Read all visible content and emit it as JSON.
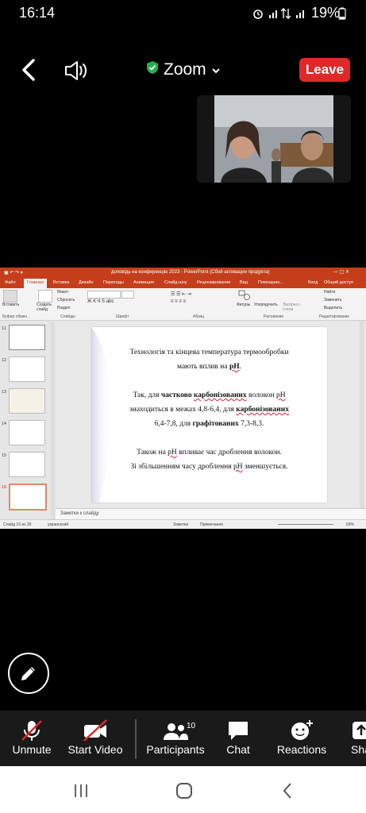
{
  "status_bar": {
    "time": "16:14",
    "battery": "19%"
  },
  "header": {
    "app_title": "Zoom",
    "leave_label": "Leave",
    "accent_leave": "#e02828",
    "shield_color": "#22b14c"
  },
  "ppt": {
    "window_title": "доповідь на конференцію 2023 - PowerPoint (Сбой активации продукта)",
    "tabs": [
      "Файл",
      "Главная",
      "Вставка",
      "Дизайн",
      "Переходы",
      "Анимация",
      "Слайд-шоу",
      "Рецензирование",
      "Вид",
      "Помощник..."
    ],
    "right_tabs": [
      "Вход",
      "Общий доступ"
    ],
    "ribbon_groups": [
      "Буфер обмен...",
      "Слайды",
      "Шрифт",
      "Абзац",
      "Рисование",
      "Редактирование"
    ],
    "ribbon_buttons": {
      "paste": "Вставить",
      "new_slide": "Создать слайд",
      "layout": "Макет",
      "reset": "Сбросить",
      "section": "Раздел",
      "shapes": "Фигуры",
      "arrange": "Упорядочить",
      "quick_styles": "Экспресс-стили",
      "find": "Найти",
      "replace": "Заменить",
      "select": "Выделить"
    },
    "slide_numbers": [
      "11",
      "12",
      "13",
      "14",
      "15",
      "16"
    ],
    "slide": {
      "line1": "Технологія та кінцева температура термообробки",
      "line2_pre": "мають вплив на ",
      "line2_ph": "рН",
      "line2_post": ".",
      "line3_pre": "Так, для ",
      "line3_b1": "частково",
      "line3_mid": " ",
      "line3_b2": "карбонізованих",
      "line3_post": " волокон ",
      "line3_ph": "рН",
      "line4_pre": "знаходиться в межах 4,8-6,4, для ",
      "line4_b": "карбонізованих",
      "line5_pre": "6,4-7,8, для ",
      "line5_b": "графітованих",
      "line5_post": " 7,3-8,3.",
      "line6_pre": "Також на ",
      "line6_ph": "рН",
      "line6_post": " впливає час дроблення волокон.",
      "line7_pre": "Зі збільшенням часу дроблення ",
      "line7_ph": "рН",
      "line7_post": " зменшується."
    },
    "notes_label": "Заметки к слайду",
    "status_slide": "Слайд 16 из 30",
    "status_lang": "украинский",
    "status_notes": "Заметки",
    "status_comments": "Примечания",
    "zoom_level": "69%"
  },
  "toolbar": {
    "unmute": "Unmute",
    "start_video": "Start Video",
    "participants": "Participants",
    "participants_count": "10",
    "chat": "Chat",
    "reactions": "Reactions",
    "share": "Sha"
  }
}
